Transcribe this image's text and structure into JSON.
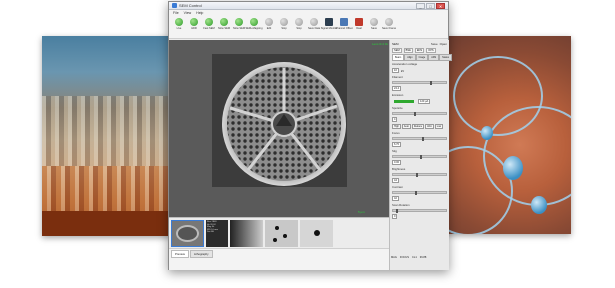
{
  "window": {
    "title": "SEM Control",
    "controls": [
      "_",
      "□",
      "✕"
    ]
  },
  "menu": [
    "File",
    "View",
    "Help"
  ],
  "toolbar": [
    {
      "label": "Live",
      "icon": "green"
    },
    {
      "label": "HDR",
      "icon": "green"
    },
    {
      "label": "Fast SEM",
      "icon": "green"
    },
    {
      "label": "Slow SEM",
      "icon": "green"
    },
    {
      "label": "Slow SEM",
      "icon": "green"
    },
    {
      "label": "SEM+Mapping",
      "icon": "green"
    },
    {
      "label": "Edit",
      "icon": "gray"
    },
    {
      "label": "Stop",
      "icon": "gray"
    },
    {
      "label": "Stop",
      "icon": "gray"
    },
    {
      "label": "Save Data",
      "icon": "gray"
    },
    {
      "label": "Signal Monitor",
      "icon": "dark"
    },
    {
      "label": "Channel Offset",
      "icon": "blue"
    },
    {
      "label": "Deal",
      "icon": "red"
    },
    {
      "label": "Save",
      "icon": "gray"
    },
    {
      "label": "Save Frame",
      "icon": "gray"
    }
  ],
  "viewport": {
    "badge": "Lens lit 2.0x",
    "scale": "5 μm"
  },
  "thumbnails": {
    "info_lines": [
      "Run 2809",
      "Hv 20 kV",
      "Mag 5k",
      "WD 10 mm",
      "Det SE"
    ]
  },
  "bottom_tabs": [
    "Preview",
    "Lithography"
  ],
  "panel": {
    "header": "SEM",
    "save_label": "Save",
    "open_label": "Open",
    "mode_chips": [
      "SEM",
      "BSE",
      "EDS",
      "OPS"
    ],
    "tabs": [
      "Beam",
      "Align",
      "Image",
      "ADS",
      "Status"
    ],
    "accel_title": "Acceleration voltage",
    "accel_value": "10",
    "accel_unit": "kV",
    "filament_title": "Filament",
    "filament_value": "24.4",
    "emission_title": "Emission",
    "emission_value": "120 μA",
    "spot_title": "Spotsize",
    "spot_value": "4",
    "mag_buttons": [
      "High",
      "Auto",
      "Reduce",
      "LDA",
      "Low"
    ],
    "focus_title": "Focus",
    "focus_value": "6.70",
    "stig_title": "Stig",
    "stig_value": "0.00",
    "brightness_title": "Brightness",
    "brightness_value": "44",
    "contrast_title": "Contrast",
    "contrast_value": "42",
    "scan_title": "Scan Rotation",
    "scan_value": "0",
    "status_items": [
      "MAG",
      "FOCUS",
      "CL1",
      "36.88"
    ]
  }
}
